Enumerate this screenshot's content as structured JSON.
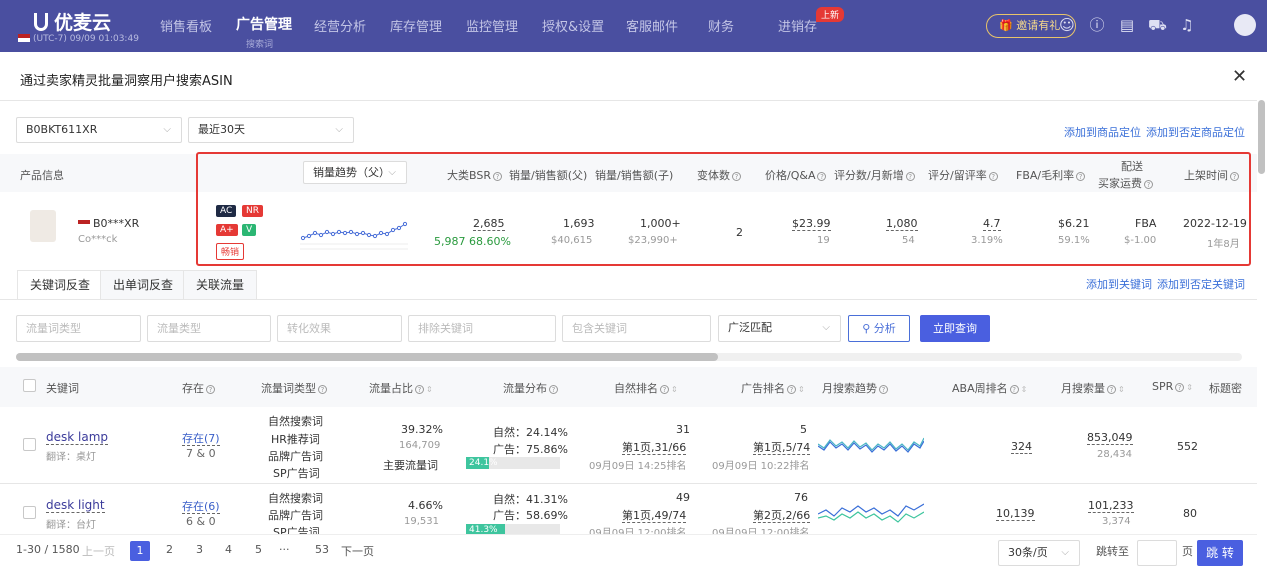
{
  "nav": {
    "logo": "优麦云",
    "timezone": "(UTC-7) 09/09 01:03:49",
    "items": [
      "销售看板",
      "广告管理",
      "经营分析",
      "库存管理",
      "监控管理",
      "授权&设置",
      "客服邮件",
      "财务",
      "进销存"
    ],
    "active_sub": "搜索词",
    "new_badge": "上新",
    "invite": "邀请有礼"
  },
  "modal": {
    "title": "通过卖家精灵批量洞察用户搜索ASIN",
    "asin_select": "B0BKT611XR",
    "range_select": "最近30天",
    "link_add_target": "添加到商品定位",
    "link_add_negative": "添加到否定商品定位"
  },
  "product_table": {
    "headers": {
      "info": "产品信息",
      "trend": "销量趋势（父）",
      "bsr": "大类BSR",
      "sales_parent": "销量/销售额(父)",
      "sales_child": "销量/销售额(子)",
      "variants": "变体数",
      "price": "价格/Q&A",
      "reviews": "评分数/月新增",
      "rating": "评分/留评率",
      "fba": "FBA/毛利率",
      "ship_line1": "配送",
      "ship_line2": "买家运费",
      "listed": "上架时间"
    },
    "row": {
      "asin": "B0***XR",
      "brand": "Co***ck",
      "badges": [
        "AC",
        "NR",
        "A+",
        "V",
        "畅销"
      ],
      "bsr": "2,685",
      "bsr_sub": "5,987",
      "bsr_pct": "68.60%",
      "sales_parent": "1,693",
      "revenue_parent": "$40,615",
      "sales_child": "1,000+",
      "revenue_child": "$23,990+",
      "variants": "2",
      "price": "$23.99",
      "qa": "19",
      "reviews": "1,080",
      "reviews_new": "54",
      "rating": "4.7",
      "review_rate": "3.19%",
      "fba": "$6.21",
      "margin": "59.1%",
      "ship": "FBA",
      "ship_fee": "$-1.00",
      "listed_date": "2022-12-19",
      "listed_age": "1年8月"
    }
  },
  "tabs": [
    "关键词反查",
    "出单词反查",
    "关联流量"
  ],
  "links2": {
    "add_kw": "添加到关键词",
    "add_neg_kw": "添加到否定关键词"
  },
  "filters": {
    "f1": "流量词类型",
    "f2": "流量类型",
    "f3": "转化效果",
    "f4": "排除关键词",
    "f5": "包含关键词",
    "match": "广泛匹配",
    "analyze": "分析",
    "query": "立即查询"
  },
  "kw_table": {
    "headers": [
      "关键词",
      "存在",
      "流量词类型",
      "流量占比",
      "流量分布",
      "自然排名",
      "广告排名",
      "月搜索趋势",
      "ABA周排名",
      "月搜索量",
      "SPR",
      "标题密"
    ],
    "rows": [
      {
        "kw": "desk lamp",
        "trans": "翻译：桌灯",
        "exist": "存在(7)",
        "exist_sub": "7 & 0",
        "types": [
          "自然搜索词",
          "HR推荐词",
          "品牌广告词",
          "SP广告词"
        ],
        "share": "39.32%",
        "share_sub": "164,709",
        "share_tag": "主要流量词",
        "natural": "自然：24.14%",
        "ad": "广告：75.86%",
        "bar_label": "24.1%",
        "bar_fraction": 0.241,
        "org_rank": "31",
        "org_page": "第1页,31/66",
        "org_time": "09月09日 14:25排名",
        "ad_rank": "5",
        "ad_page": "第1页,5/74",
        "ad_time": "09月09日 10:22排名",
        "aba": "324",
        "volume": "853,049",
        "volume_sub": "28,434",
        "spr": "552"
      },
      {
        "kw": "desk light",
        "trans": "翻译：台灯",
        "exist": "存在(6)",
        "exist_sub": "6 & 0",
        "types": [
          "自然搜索词",
          "品牌广告词",
          "SP广告词"
        ],
        "share": "4.66%",
        "share_sub": "19,531",
        "share_tag": "",
        "natural": "自然：41.31%",
        "ad": "广告：58.69%",
        "bar_label": "41.3%",
        "bar_fraction": 0.413,
        "org_rank": "49",
        "org_page": "第1页,49/74",
        "org_time": "09月09日 12:00排名",
        "ad_rank": "76",
        "ad_page": "第2页,2/66",
        "ad_time": "09月09日 12:00排名",
        "aba": "10,139",
        "volume": "101,233",
        "volume_sub": "3,374",
        "spr": "80"
      }
    ]
  },
  "pagination": {
    "summary": "1-30 / 1580",
    "prev": "上一页",
    "pages": [
      "1",
      "2",
      "3",
      "4",
      "5",
      "···",
      "53"
    ],
    "next": "下一页",
    "page_size": "30条/页",
    "jump_label": "跳转至",
    "page_unit": "页",
    "jump_btn": "跳 转"
  }
}
